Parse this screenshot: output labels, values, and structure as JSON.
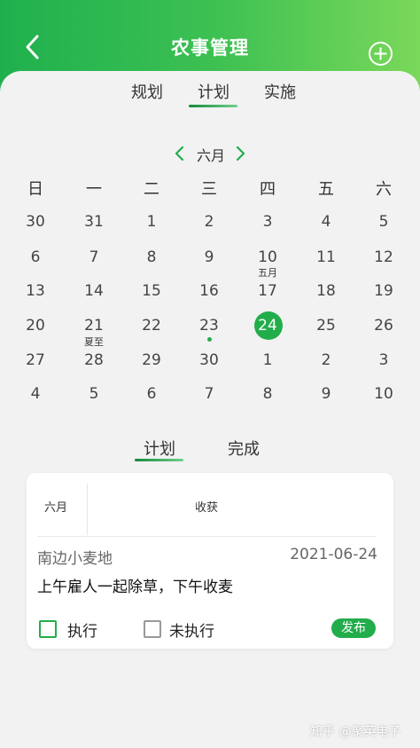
{
  "header": {
    "title": "农事管理"
  },
  "tabs": [
    "规划",
    "计划",
    "实施"
  ],
  "calendar": {
    "month": "六月",
    "weekdays": [
      "日",
      "一",
      "二",
      "三",
      "四",
      "五",
      "六"
    ],
    "rows": [
      [
        "30",
        "31",
        "1",
        "2",
        "3",
        "4",
        "5"
      ],
      [
        "6",
        "7",
        "8",
        "9",
        "10",
        "11",
        "12"
      ],
      [
        "13",
        "14",
        "15",
        "16",
        "17",
        "18",
        "19"
      ],
      [
        "20",
        "21",
        "22",
        "23",
        "24",
        "25",
        "26"
      ],
      [
        "27",
        "28",
        "29",
        "30",
        "1",
        "2",
        "3"
      ],
      [
        "4",
        "5",
        "6",
        "7",
        "8",
        "9",
        "10"
      ]
    ],
    "notes": {
      "lunar_month": "五月",
      "solar_term": "夏至"
    }
  },
  "lower_tabs": [
    "计划",
    "完成"
  ],
  "card": {
    "month": "六月",
    "action": "收获",
    "field": "南边小麦地",
    "date": "2021-06-24",
    "description": "上午雇人一起除草，下午收麦",
    "execute_label": "执行",
    "not_execute_label": "未执行",
    "publish_label": "发布"
  },
  "watermark": "知乎 @聚英电子",
  "colors": {
    "accent": "#22ad4b",
    "header_start": "#1fb04e",
    "header_end": "#7ad85a"
  }
}
